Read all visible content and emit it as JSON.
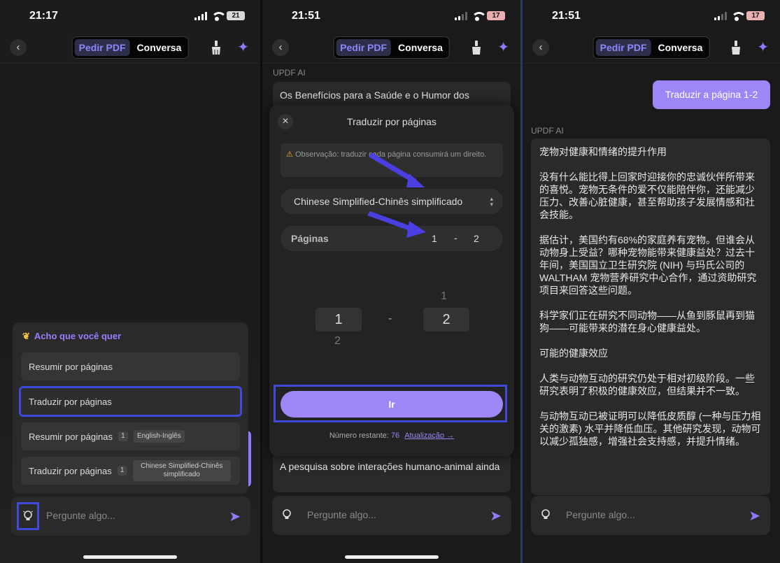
{
  "phone1": {
    "time": "21:17",
    "battery": "21",
    "header": {
      "tab_pdf": "Pedir PDF",
      "tab_chat": "Conversa"
    },
    "suggestions": {
      "title": "Acho que você quer",
      "items": [
        {
          "label": "Resumir por páginas"
        },
        {
          "label": "Traduzir por páginas"
        },
        {
          "label": "Resumir por páginas",
          "count": "1",
          "tag": "English-Inglês"
        },
        {
          "label": "Traduzir por páginas",
          "count": "1",
          "tag": "Chinese Simplified-Chinês simplificado"
        }
      ]
    },
    "input_placeholder": "Pergunte algo..."
  },
  "phone2": {
    "time": "21:51",
    "battery": "17",
    "header": {
      "tab_pdf": "Pedir PDF",
      "tab_chat": "Conversa"
    },
    "ai_label": "UPDF AI",
    "bubble_top": "Os Benefícios para a Saúde e o Humor dos",
    "bubble_bottom": "A pesquisa sobre interações humano-animal ainda",
    "modal": {
      "title": "Traduzir por páginas",
      "note_prefix": "⚠",
      "note": "Observação: traduzir cada página consumirá um direito.",
      "language": "Chinese Simplified-Chinês simplificado",
      "pages_label": "Páginas",
      "page_from": "1",
      "page_dash": "-",
      "page_to": "2",
      "picker": {
        "from": "1",
        "from_below": "2",
        "dash": "-",
        "to": "2",
        "to_above": "1"
      },
      "go_label": "Ir",
      "remaining_label": "Número restante:",
      "remaining_count": "76",
      "upgrade_label": "Atualização →"
    },
    "input_placeholder": "Pergunte algo..."
  },
  "phone3": {
    "time": "21:51",
    "battery": "17",
    "header": {
      "tab_pdf": "Pedir PDF",
      "tab_chat": "Conversa"
    },
    "user_message": "Traduzir a página 1-2",
    "ai_label": "UPDF AI",
    "paragraphs": [
      "宠物对健康和情绪的提升作用",
      "没有什么能比得上回家时迎接你的忠诚伙伴所带来的喜悦。宠物无条件的爱不仅能陪伴你，还能减少压力、改善心脏健康，甚至帮助孩子发展情感和社会技能。",
      "据估计，美国约有68%的家庭养有宠物。但谁会从动物身上受益？哪种宠物能带来健康益处？过去十年间，美国国立卫生研究院 (NIH) 与玛氏公司的 WALTHAM 宠物营养研究中心合作，通过资助研究项目来回答这些问题。",
      "科学家们正在研究不同动物——从鱼到豚鼠再到猫狗——可能带来的潜在身心健康益处。",
      "可能的健康效应",
      "人类与动物互动的研究仍处于相对初级阶段。一些研究表明了积极的健康效应，但结果并不一致。",
      "与动物互动已被证明可以降低皮质醇 (一种与压力相关的激素) 水平并降低血压。其他研究发现，动物可以减少孤独感，增强社会支持感，并提升情绪。"
    ],
    "input_placeholder": "Pergunte algo..."
  },
  "colors": {
    "accent": "#9f86f7",
    "highlight": "#3d4bd8"
  }
}
